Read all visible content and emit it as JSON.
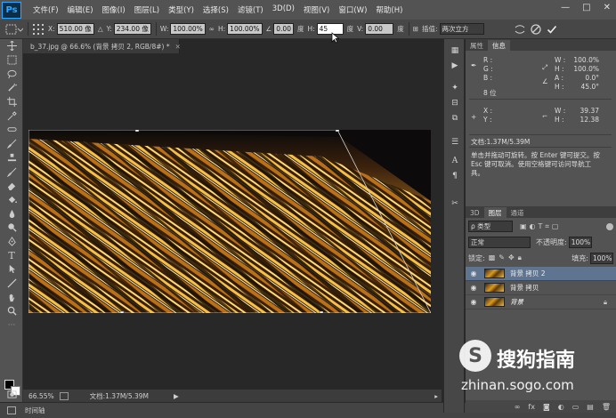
{
  "menubar": {
    "logo": "Ps",
    "items": [
      "文件(F)",
      "编辑(E)",
      "图像(I)",
      "图层(L)",
      "类型(Y)",
      "选择(S)",
      "滤镜(T)",
      "3D(D)",
      "视图(V)",
      "窗口(W)",
      "帮助(H)"
    ],
    "controls": {
      "min": "—",
      "max": "□",
      "close": "✕"
    }
  },
  "options": {
    "x_label": "X:",
    "x_value": "510.00 像",
    "y_label": "Y:",
    "y_value": "234.00 像",
    "w_label": "W:",
    "w_value": "100.00%",
    "h_label": "H:",
    "h_value": "100.00%",
    "angle_value": "0.00",
    "angle_unit": "度",
    "hskew_label": "H:",
    "hskew_value": "45",
    "hskew_unit": "度",
    "vskew_label": "V:",
    "vskew_value": "0.00",
    "vskew_unit": "度",
    "interp_label": "插值:",
    "interp_value": "两次立方",
    "cancel_icon": "cancel-icon",
    "commit_icon": "checkmark-icon"
  },
  "document": {
    "tab_title": "b_37.jpg @ 66.6% (背景 拷贝 2, RGB/8#) *",
    "zoom": "66.55%",
    "doc_size": "文档:1.37M/5.39M"
  },
  "timeline": {
    "label": "时间轴"
  },
  "info_panel": {
    "tabs": [
      "属性",
      "信息"
    ],
    "r_label": "R :",
    "g_label": "G :",
    "b_label": "B :",
    "bit_depth": "8 位",
    "w_label": "W :",
    "w_value": "100.0%",
    "h_label": "H :",
    "h_value": "100.0%",
    "a_label": "A :",
    "a_value": "0.0°",
    "h2_label": "H :",
    "h2_value": "45.0°",
    "x_label": "X :",
    "y_label": "Y :",
    "w2_label": "W :",
    "w2_value": "39.37",
    "h3_label": "H :",
    "h3_value": "12.38",
    "doc_size": "文档:1.37M/5.39M",
    "hint": "单击并拖动可旋转。按 Enter 键可提交。按 Esc 键可取消。使用空格键可访问导航工具。"
  },
  "layers_panel": {
    "tabs": [
      "3D",
      "图层",
      "通道"
    ],
    "filter_label": "ρ 类型",
    "blend_mode": "正常",
    "opacity_label": "不透明度:",
    "opacity_value": "100%",
    "lock_label": "锁定:",
    "fill_label": "填充:",
    "fill_value": "100%",
    "layers": [
      {
        "name": "背景 拷贝 2",
        "selected": true,
        "locked": false
      },
      {
        "name": "背景 拷贝",
        "selected": false,
        "locked": false
      },
      {
        "name": "背景",
        "selected": false,
        "locked": true
      }
    ]
  },
  "watermark": {
    "brand": "搜狗指南",
    "url": "zhinan.sogo.com"
  },
  "colors": {
    "ps_blue": "#31a8ff",
    "selection": "#5f7491",
    "panel": "#535353"
  }
}
